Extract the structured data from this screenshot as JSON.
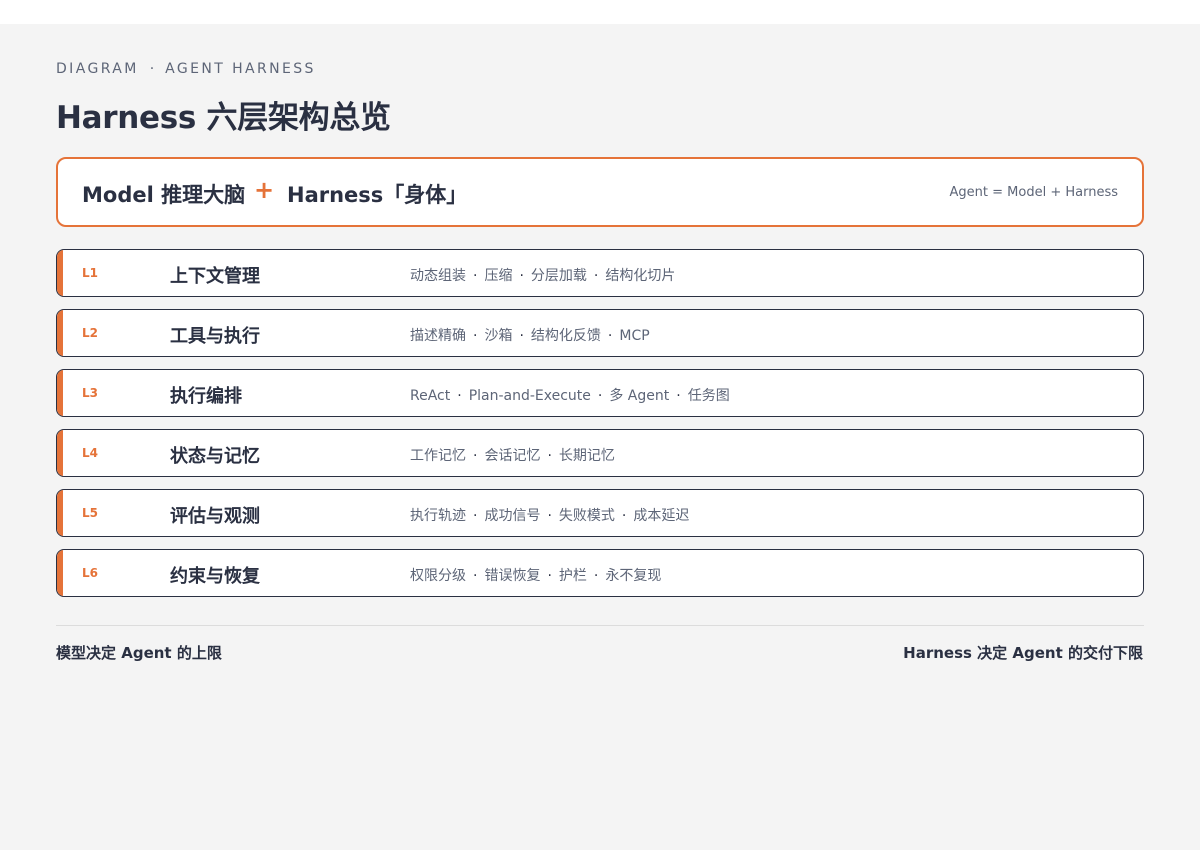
{
  "header": {
    "eyebrow_left": "DIAGRAM",
    "eyebrow_sep": "·",
    "eyebrow_right": "AGENT HARNESS",
    "title": "Harness 六层架构总览"
  },
  "formula": {
    "model": "Model 推理大脑",
    "plus": "+",
    "harness": "Harness「身体」",
    "equation": "Agent = Model + Harness"
  },
  "layers": [
    {
      "code": "L1",
      "name": "上下文管理",
      "items": [
        "动态组装",
        "压缩",
        "分层加载",
        "结构化切片"
      ]
    },
    {
      "code": "L2",
      "name": "工具与执行",
      "items": [
        "描述精确",
        "沙箱",
        "结构化反馈",
        "MCP"
      ]
    },
    {
      "code": "L3",
      "name": "执行编排",
      "items": [
        "ReAct",
        "Plan-and-Execute",
        "多 Agent",
        "任务图"
      ]
    },
    {
      "code": "L4",
      "name": "状态与记忆",
      "items": [
        "工作记忆",
        "会话记忆",
        "长期记忆"
      ]
    },
    {
      "code": "L5",
      "name": "评估与观测",
      "items": [
        "执行轨迹",
        "成功信号",
        "失败模式",
        "成本延迟"
      ]
    },
    {
      "code": "L6",
      "name": "约束与恢复",
      "items": [
        "权限分级",
        "错误恢复",
        "护栏",
        "永不复现"
      ]
    }
  ],
  "item_separator": "·",
  "footer": {
    "left": "模型决定 Agent 的上限",
    "right": "Harness 决定 Agent 的交付下限"
  },
  "colors": {
    "accent": "#e57339",
    "ink": "#2a3042",
    "muted": "#5d6577",
    "canvas": "#f4f4f4"
  }
}
